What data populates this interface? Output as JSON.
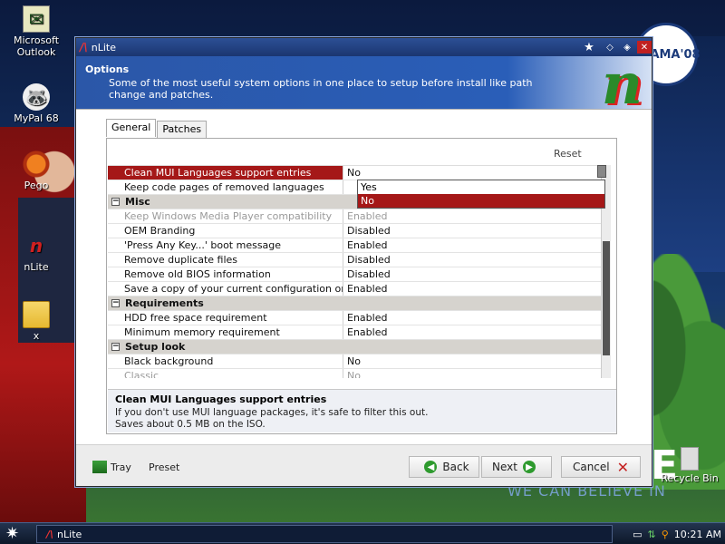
{
  "desktop": {
    "icons": [
      {
        "label": "Microsoft\nOutlook",
        "icon": "outlook-icon"
      },
      {
        "label": "MyPal 68",
        "icon": "mypal-icon"
      },
      {
        "label": "Pego",
        "icon": "pego-icon"
      },
      {
        "label": "nLite",
        "icon": "nlite-icon"
      },
      {
        "label": "x",
        "icon": "folder-icon"
      },
      {
        "label": "Recycle Bin",
        "icon": "recycle-bin-icon"
      }
    ],
    "wallpaper_text": {
      "badge": "AMA'08",
      "slogan": "WE CAN BELIEVE IN",
      "big_letter": "E"
    }
  },
  "window": {
    "title": "nLite",
    "title_icon": "nlite-logo-icon",
    "header": {
      "title": "Options",
      "description": "Some of the most useful system options in one place to setup before install like path change and patches."
    },
    "tabs": [
      {
        "label": "General",
        "active": true
      },
      {
        "label": "Patches",
        "active": false
      }
    ],
    "reset_label": "Reset",
    "rows": [
      {
        "type": "item",
        "key": "Clean MUI Languages support entries",
        "value": "No",
        "selected": true
      },
      {
        "type": "item",
        "key": "Keep code pages of removed languages",
        "value": ""
      },
      {
        "type": "category",
        "key": "Misc"
      },
      {
        "type": "item",
        "key": "Keep Windows Media Player compatibility",
        "value": "Enabled",
        "dim": true
      },
      {
        "type": "item",
        "key": "OEM Branding",
        "value": "Disabled"
      },
      {
        "type": "item",
        "key": "'Press Any Key...' boot message",
        "value": "Enabled"
      },
      {
        "type": "item",
        "key": "Remove duplicate files",
        "value": "Disabled"
      },
      {
        "type": "item",
        "key": "Remove old BIOS information",
        "value": "Disabled"
      },
      {
        "type": "item",
        "key": "Save a copy of your current configuration on the ISO",
        "value": "Enabled"
      },
      {
        "type": "category",
        "key": "Requirements"
      },
      {
        "type": "item",
        "key": "HDD free space requirement",
        "value": "Enabled"
      },
      {
        "type": "item",
        "key": "Minimum memory requirement",
        "value": "Enabled"
      },
      {
        "type": "category",
        "key": "Setup look"
      },
      {
        "type": "item",
        "key": "Black background",
        "value": "No"
      },
      {
        "type": "item",
        "key": "Classic",
        "value": "No",
        "dim": true
      }
    ],
    "dropdown": {
      "options": [
        "Yes",
        "No"
      ],
      "highlighted": "No"
    },
    "description": {
      "title": "Clean MUI Languages support entries",
      "text1": "If you don't use MUI language packages, it's safe to filter this out.",
      "text2": "Saves about 0.5 MB on the ISO."
    },
    "footer": {
      "tray_label": "Tray",
      "preset_label": "Preset",
      "back_label": "Back",
      "next_label": "Next",
      "cancel_label": "Cancel"
    }
  },
  "taskbar": {
    "task_label": "nLite",
    "clock": "10:21 AM"
  }
}
